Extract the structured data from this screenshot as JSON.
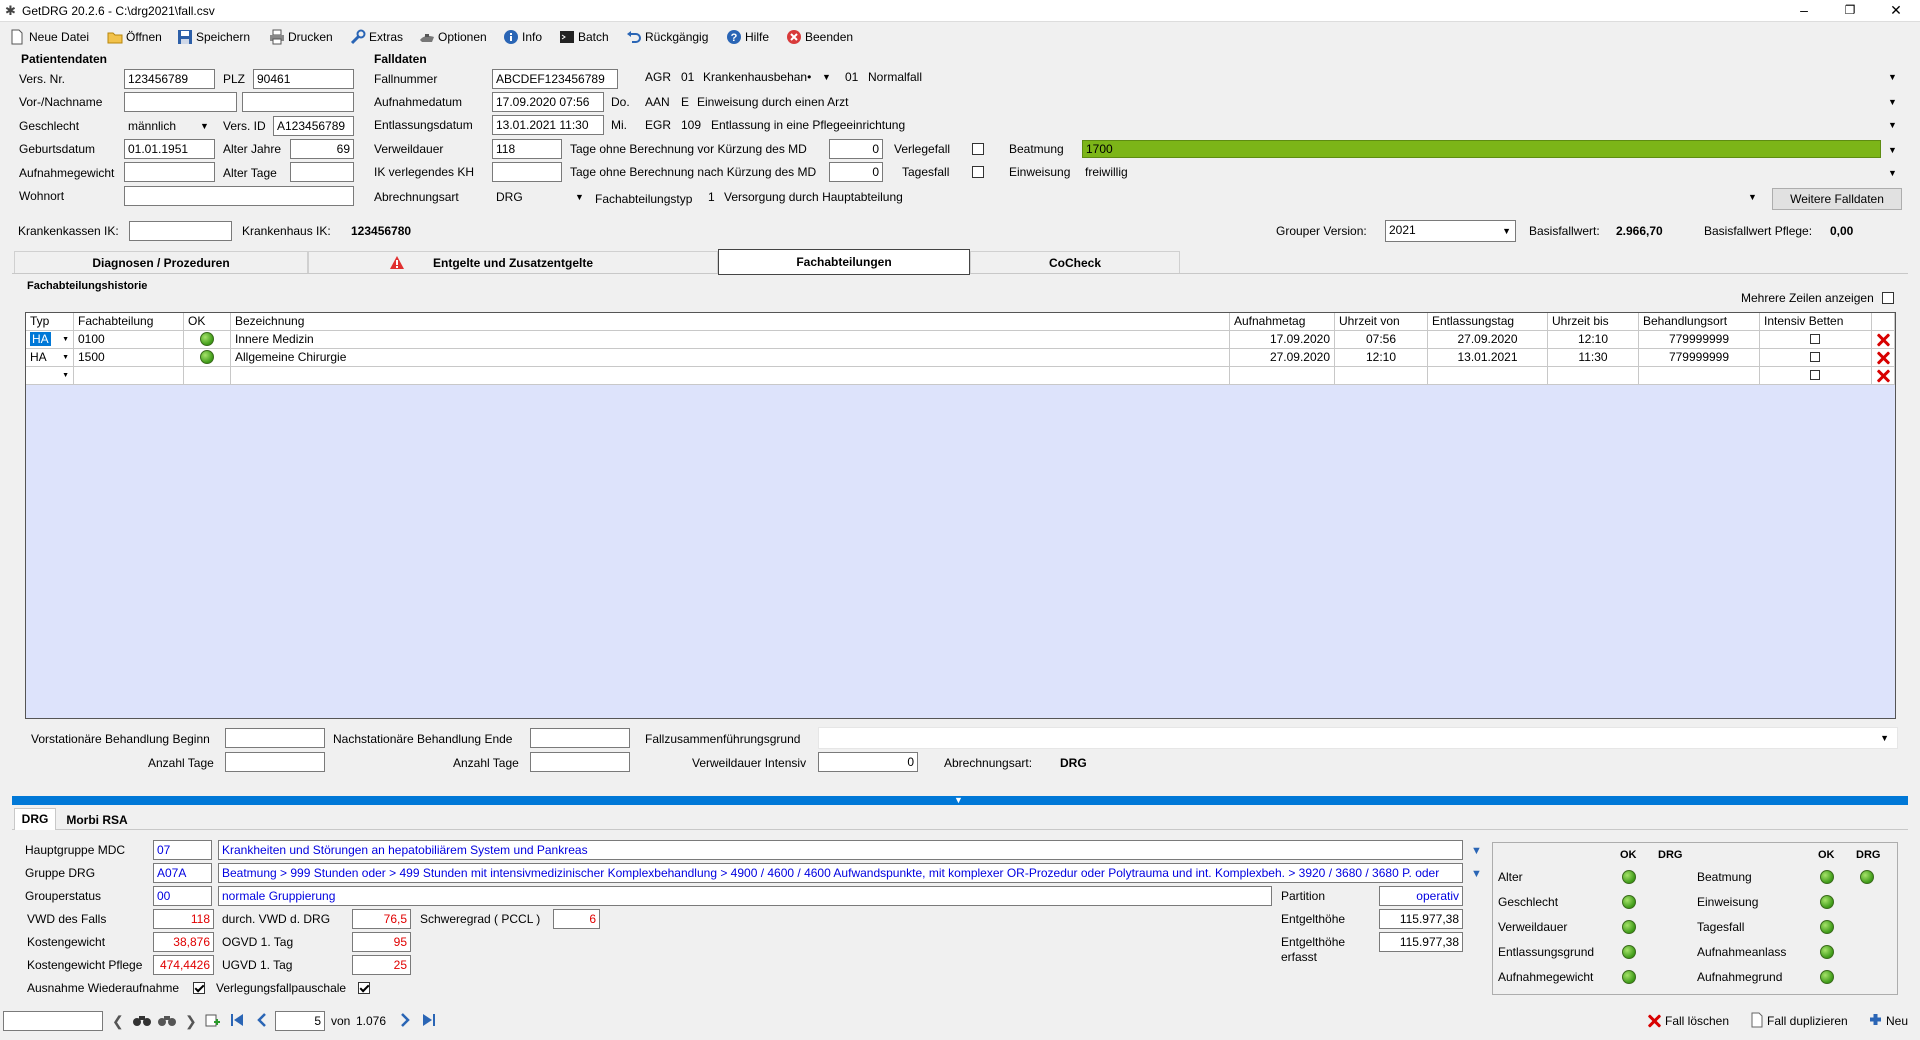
{
  "window": {
    "title": "GetDRG 20.2.6 - C:\\drg2021\\fall.csv"
  },
  "toolbar": {
    "new": "Neue Datei",
    "open": "Öffnen",
    "save": "Speichern",
    "print": "Drucken",
    "extras": "Extras",
    "options": "Optionen",
    "info": "Info",
    "batch": "Batch",
    "undo": "Rückgängig",
    "help": "Hilfe",
    "exit": "Beenden"
  },
  "patient": {
    "header": "Patientendaten",
    "vers_nr_label": "Vers. Nr.",
    "vers_nr": "123456789",
    "plz_label": "PLZ",
    "plz": "90461",
    "name_label": "Vor-/Nachname",
    "vorname": "",
    "nachname": "",
    "geschlecht_label": "Geschlecht",
    "geschlecht": "männlich",
    "vers_id_label": "Vers. ID",
    "vers_id": "A123456789",
    "geburtsdatum_label": "Geburtsdatum",
    "geburtsdatum": "01.01.1951",
    "alter_jahre_label": "Alter Jahre",
    "alter_jahre": "69",
    "aufnahmegewicht_label": "Aufnahmegewicht",
    "aufnahmegewicht": "",
    "alter_tage_label": "Alter Tage",
    "alter_tage": "",
    "wohnort_label": "Wohnort",
    "wohnort": ""
  },
  "falldaten": {
    "header": "Falldaten",
    "fallnummer_label": "Fallnummer",
    "fallnummer": "ABCDEF123456789",
    "agr_label": "AGR",
    "agr_code": "01",
    "agr_value": "Krankenhausbehan•",
    "agr_code2": "01",
    "agr_value2": "Normalfall",
    "aufnahmedatum_label": "Aufnahmedatum",
    "aufnahmedatum": "17.09.2020 07:56",
    "aufnahme_day": "Do.",
    "aan_label": "AAN",
    "aan_code": "E",
    "aan_value": "Einweisung durch einen Arzt",
    "entlassungsdatum_label": "Entlassungsdatum",
    "entlassungsdatum": "13.01.2021 11:30",
    "entlassung_day": "Mi.",
    "egr_label": "EGR",
    "egr_code": "109",
    "egr_value": "Entlassung in eine Pflegeeinrichtung",
    "verweildauer_label": "Verweildauer",
    "verweildauer": "118",
    "tage_vor_label": "Tage ohne Berechnung vor Kürzung des MD",
    "tage_vor": "0",
    "verlegefall_label": "Verlegefall",
    "beatmung_label": "Beatmung",
    "beatmung": "1700",
    "ik_kh_label": "IK verlegendes KH",
    "ik_kh": "",
    "tage_nach_label": "Tage ohne Berechnung nach Kürzung des MD",
    "tage_nach": "0",
    "tagesfall_label": "Tagesfall",
    "einweisung_label": "Einweisung",
    "einweisung": "freiwillig",
    "abrechnungsart_label": "Abrechnungsart",
    "abrechnungsart": "DRG",
    "fachabteilungstyp_label": "Fachabteilungstyp",
    "fachabteilungstyp_code": "1",
    "fachabteilungstyp": "Versorgung durch Hauptabteilung",
    "weitere_button": "Weitere Falldaten"
  },
  "ik": {
    "kasse_label": "Krankenkassen IK:",
    "kasse": "",
    "kh_label": "Krankenhaus IK:",
    "kh": "123456780",
    "grouper_label": "Grouper Version:",
    "grouper": "2021",
    "basis_label": "Basisfallwert:",
    "basis": "2.966,70",
    "basis_pflege_label": "Basisfallwert Pflege:",
    "basis_pflege": "0,00"
  },
  "tabs": {
    "diag": "Diagnosen / Prozeduren",
    "entgelte": "Entgelte und Zusatzentgelte",
    "fach": "Fachabteilungen",
    "cocheck": "CoCheck"
  },
  "history": {
    "header": "Fachabteilungshistorie",
    "mehrere_label": "Mehrere Zeilen anzeigen",
    "columns": [
      "Typ",
      "Fachabteilung",
      "OK",
      "Bezeichnung",
      "Aufnahmetag",
      "Uhrzeit von",
      "Entlassungstag",
      "Uhrzeit bis",
      "Behandlungsort",
      "Intensiv Betten"
    ],
    "rows": [
      {
        "typ": "HA",
        "fach": "0100",
        "bez": "Innere Medizin",
        "aufn": "17.09.2020",
        "von": "07:56",
        "entl": "27.09.2020",
        "bis": "12:10",
        "ort": "779999999"
      },
      {
        "typ": "HA",
        "fach": "1500",
        "bez": "Allgemeine Chirurgie",
        "aufn": "27.09.2020",
        "von": "12:10",
        "entl": "13.01.2021",
        "bis": "11:30",
        "ort": "779999999"
      }
    ]
  },
  "bottom_form": {
    "vor_label": "Vorstationäre Behandlung Beginn",
    "vor": "",
    "nach_label": "Nachstationäre Behandlung Ende",
    "nach": "",
    "zusammen_label": "Fallzusammenführungsgrund",
    "zusammen": "",
    "anzahl1_label": "Anzahl Tage",
    "anzahl1": "",
    "anzahl2_label": "Anzahl Tage",
    "anzahl2": "",
    "vwd_int_label": "Verweildauer Intensiv",
    "vwd_int": "0",
    "abr_label": "Abrechnungsart:",
    "abr": "DRG"
  },
  "drg_tabs": {
    "drg": "DRG",
    "morbi": "Morbi RSA"
  },
  "drg": {
    "mdc_label": "Hauptgruppe MDC",
    "mdc": "07",
    "mdc_text": "Krankheiten und Störungen an hepatobiliärem System und Pankreas",
    "grp_label": "Gruppe DRG",
    "grp": "A07A",
    "grp_text": "Beatmung > 999 Stunden oder > 499 Stunden mit intensivmedizinischer Komplexbehandlung > 4900 / 4600 / 4600 Aufwandspunkte, mit komplexer OR-Prozedur oder Polytrauma und int. Komplexbeh. > 3920 / 3680 / 3680 P. oder",
    "status_label": "Grouperstatus",
    "status": "00",
    "status_text": "normale Gruppierung",
    "vwd_label": "VWD des Falls",
    "vwd": "118",
    "dvwd_label": "durch. VWD d. DRG",
    "dvwd": "76,5",
    "pccl_label": "Schweregrad ( PCCL )",
    "pccl": "6",
    "kg_label": "Kostengewicht",
    "kg": "38,876",
    "ogvd_label": "OGVD 1. Tag",
    "ogvd": "95",
    "kgp_label": "Kostengewicht Pflege",
    "kgp": "474,4426",
    "ugvd_label": "UGVD 1. Tag",
    "ugvd": "25",
    "ausnahme_label": "Ausnahme Wiederaufnahme",
    "verlegung_label": "Verlegungsfallpauschale",
    "partition_label": "Partition",
    "partition": "operativ",
    "entgelt_label": "Entgelthöhe",
    "entgelt": "115.977,38",
    "entgelt_erf_label1": "Entgelthöhe",
    "entgelt_erf_label2": "erfasst",
    "entgelt_erf": "115.977,38"
  },
  "checks": {
    "ok": "OK",
    "drg": "DRG",
    "left": [
      "Alter",
      "Geschlecht",
      "Verweildauer",
      "Entlassungsgrund",
      "Aufnahmegewicht"
    ],
    "right": [
      "Beatmung",
      "Einweisung",
      "Tagesfall",
      "Aufnahmeanlass",
      "Aufnahmegrund"
    ]
  },
  "status": {
    "page": "5",
    "von": "von",
    "total": "1.076",
    "delete": "Fall löschen",
    "duplicate": "Fall duplizieren",
    "new": "Neu"
  },
  "colors": {
    "beatmung": "#7cb518",
    "grid_bg": "#dde3fb",
    "splitter": "#0078d7"
  }
}
